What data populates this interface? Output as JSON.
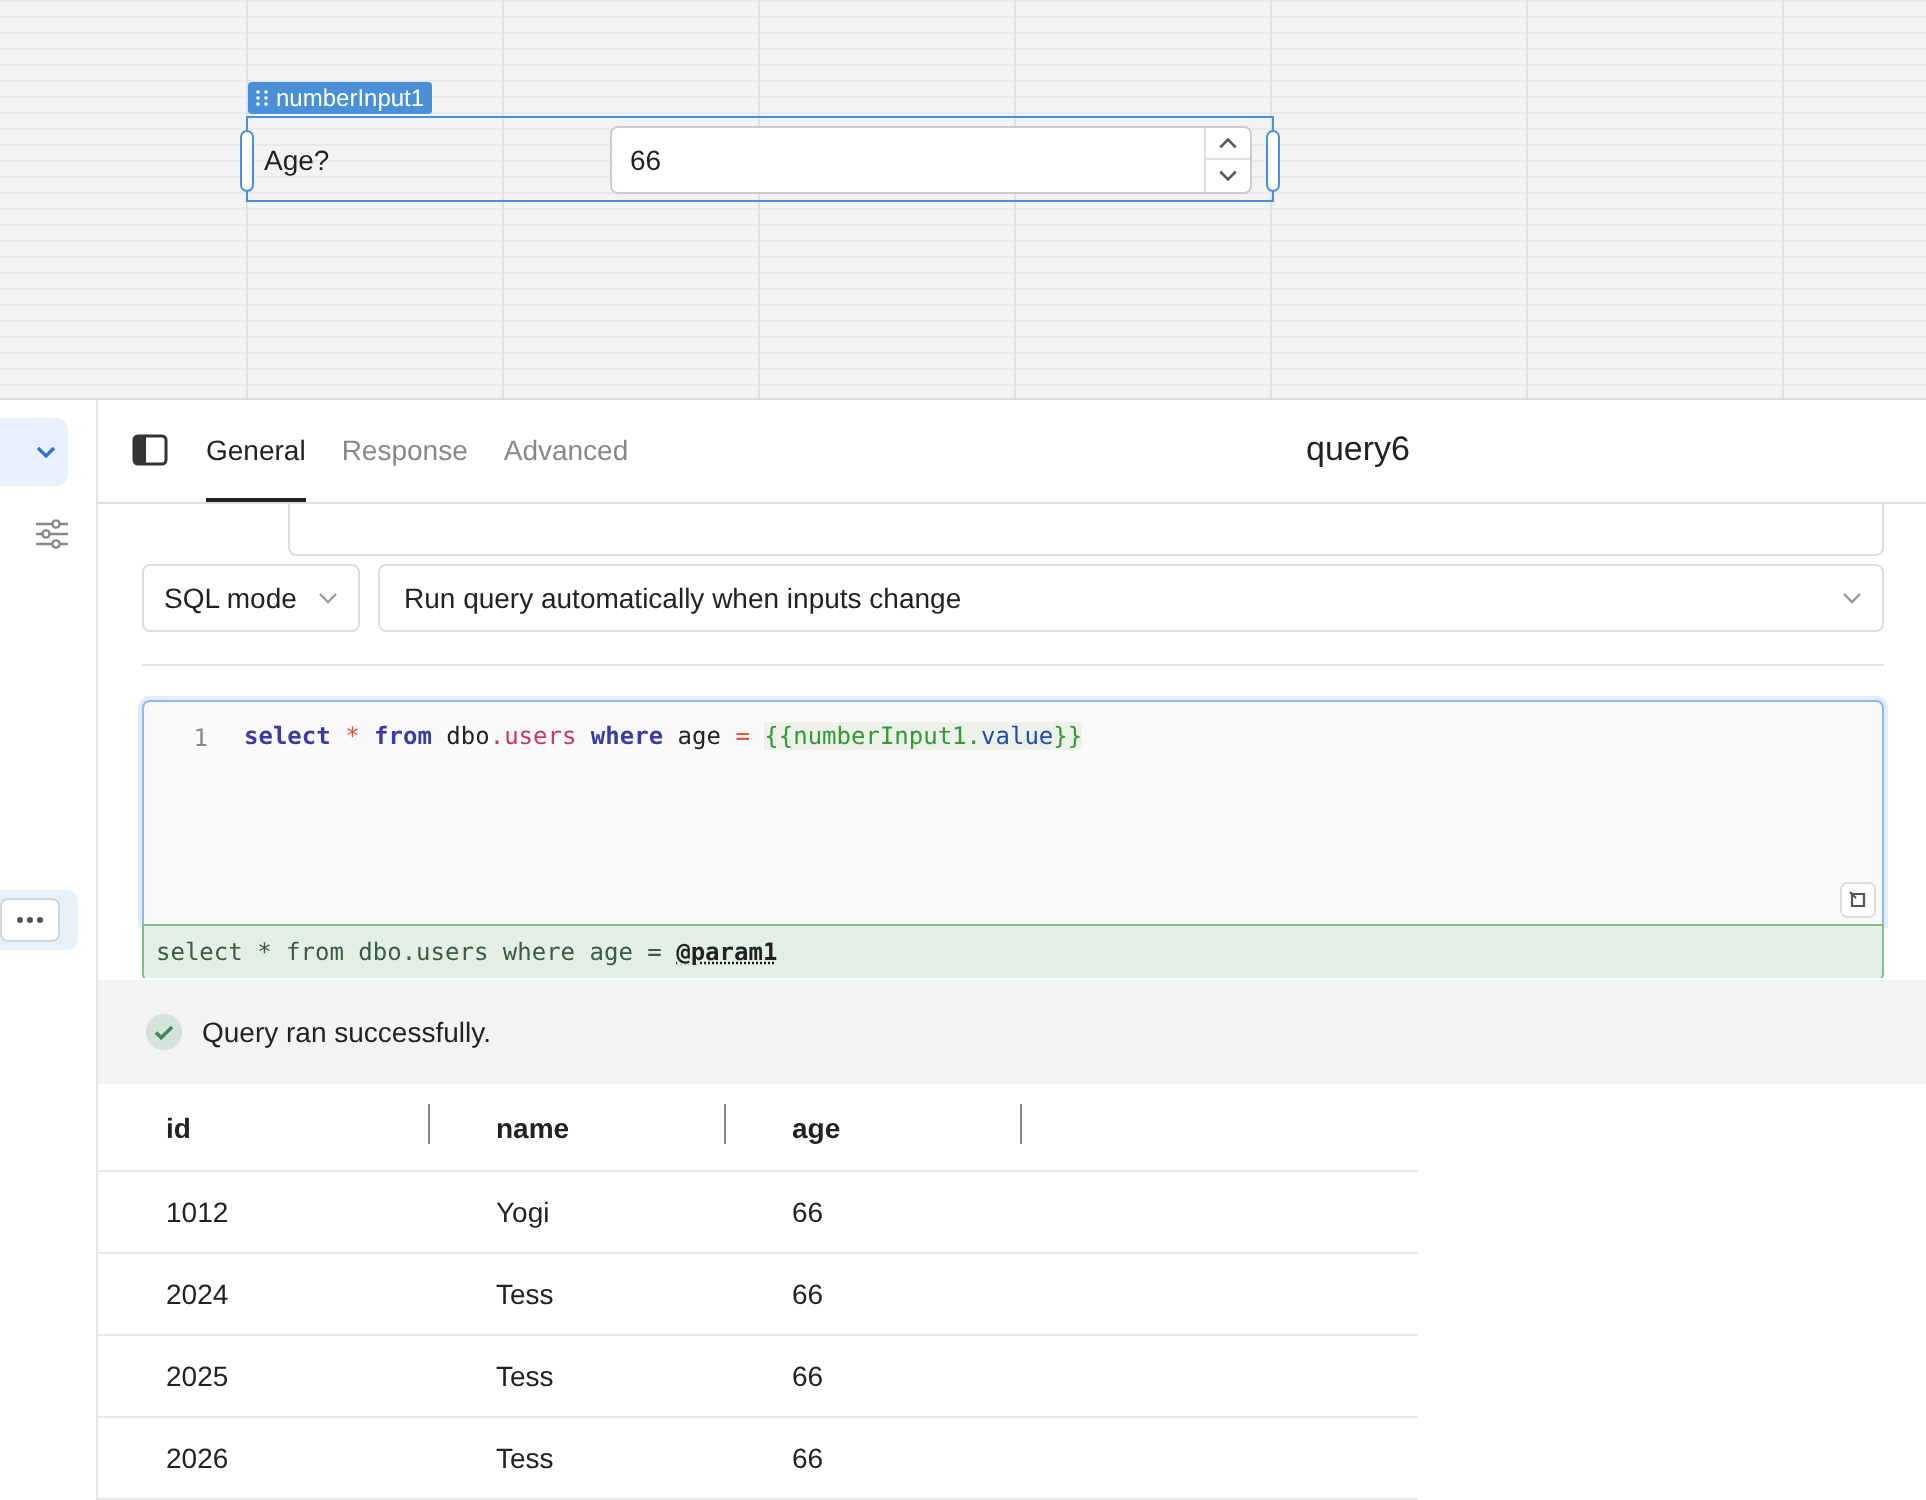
{
  "canvas": {
    "component": {
      "badge": "numberInput1",
      "label": "Age?",
      "value": "66"
    }
  },
  "tabs": [
    {
      "label": "General",
      "selected": true
    },
    {
      "label": "Response",
      "selected": false
    },
    {
      "label": "Advanced",
      "selected": false
    }
  ],
  "query_title": "query6",
  "sql_mode": "SQL mode",
  "trigger": "Run query automatically when inputs change",
  "editor": {
    "line_number": "1",
    "tokens": [
      {
        "text": "select ",
        "kind": "keyword"
      },
      {
        "text": "* ",
        "kind": "operator"
      },
      {
        "text": "from",
        "kind": "keyword"
      },
      {
        "text": " dbo",
        "kind": "plain"
      },
      {
        "text": ".users",
        "kind": "property"
      },
      {
        "text": " where",
        "kind": "keyword"
      },
      {
        "text": " age ",
        "kind": "plain"
      },
      {
        "text": "= ",
        "kind": "operator"
      },
      {
        "text": "{{numberInput1.",
        "kind": "template"
      },
      {
        "text": "value",
        "kind": "template-key"
      },
      {
        "text": "}}",
        "kind": "template"
      }
    ]
  },
  "preview": "select * from dbo.users where age = **@param1**",
  "status": "Query ran successfully.",
  "table": {
    "columns": [
      "id",
      "name",
      "age"
    ],
    "rows": [
      [
        "1012",
        "Yogi",
        "66"
      ],
      [
        "2024",
        "Tess",
        "66"
      ],
      [
        "2025",
        "Tess",
        "66"
      ],
      [
        "2026",
        "Tess",
        "66"
      ]
    ]
  }
}
